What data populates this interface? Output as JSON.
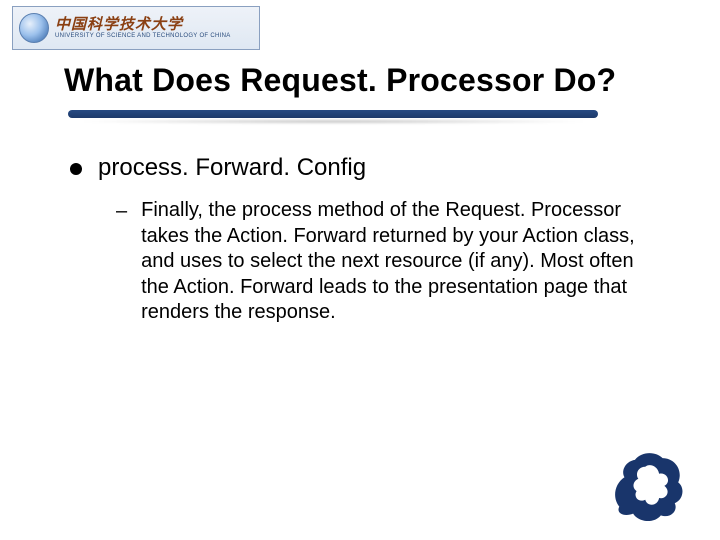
{
  "logo": {
    "cn": "中国科学技术大学",
    "en": "UNIVERSITY OF SCIENCE AND TECHNOLOGY OF CHINA"
  },
  "slide": {
    "title": "What Does Request. Processor Do?",
    "bullet1": "process. Forward. Config",
    "bullet1_sub1": "Finally, the process method of the Request. Processor takes the Action. Forward returned by your Action class, and uses to select the next resource (if any). Most often the Action. Forward leads to the presentation page that renders the response."
  },
  "colors": {
    "underline": "#1d3a6a",
    "dragon": "#19356b"
  }
}
